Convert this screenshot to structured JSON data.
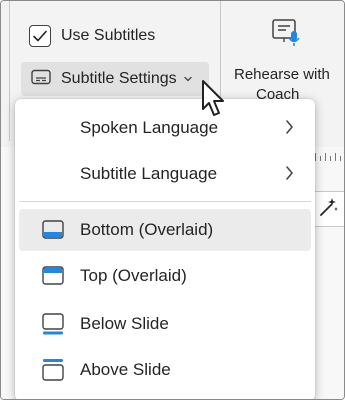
{
  "ribbon": {
    "use_subtitles": {
      "label": "Use Subtitles",
      "checked": true
    },
    "subtitle_settings": {
      "label": "Subtitle Settings"
    },
    "rehearse": {
      "label_line1": "Rehearse with",
      "label_line2": "Coach"
    }
  },
  "menu": {
    "submenus": [
      {
        "label": "Spoken Language"
      },
      {
        "label": "Subtitle Language"
      }
    ],
    "positions": [
      {
        "label": "Bottom (Overlaid)",
        "icon": "subtitle-bottom-overlaid-icon",
        "selected": true
      },
      {
        "label": "Top (Overlaid)",
        "icon": "subtitle-top-overlaid-icon",
        "selected": false
      },
      {
        "label": "Below Slide",
        "icon": "subtitle-below-slide-icon",
        "selected": false
      },
      {
        "label": "Above Slide",
        "icon": "subtitle-above-slide-icon",
        "selected": false
      }
    ]
  },
  "colors": {
    "accent": "#1e88e5",
    "ribbon_bg": "#f3f3f3",
    "selected_bg": "#ebebeb"
  }
}
